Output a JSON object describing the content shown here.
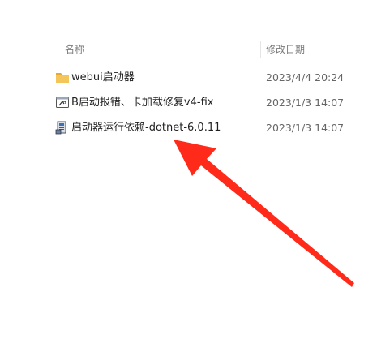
{
  "columns": {
    "name": "名称",
    "date_modified": "修改日期"
  },
  "files": [
    {
      "name": "webui启动器",
      "date": "2023/4/4 20:24",
      "icon": "folder-icon"
    },
    {
      "name": "B启动报错、卡加载修复v4-fix",
      "date": "2023/1/3 14:07",
      "icon": "shortcut-icon"
    },
    {
      "name": "启动器运行依赖-dotnet-6.0.11",
      "date": "2023/1/3 14:07",
      "icon": "installer-icon"
    }
  ],
  "annotation": {
    "icon": "red-arrow-icon",
    "color": "#ff2a1a"
  },
  "colors": {
    "folder": "#f4c55b",
    "folder_dark": "#e5aa2e",
    "header_text": "#7a7a7a"
  }
}
